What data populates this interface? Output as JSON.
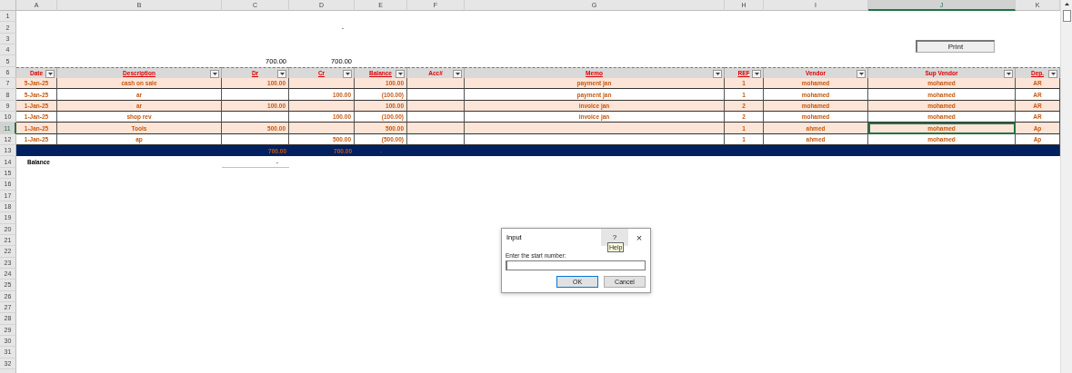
{
  "column_headers": [
    {
      "label": "A",
      "selected": false
    },
    {
      "label": "B",
      "selected": false
    },
    {
      "label": "C",
      "selected": false
    },
    {
      "label": "D",
      "selected": false
    },
    {
      "label": "E",
      "selected": false
    },
    {
      "label": "F",
      "selected": false
    },
    {
      "label": "G",
      "selected": false
    },
    {
      "label": "H",
      "selected": false
    },
    {
      "label": "I",
      "selected": false
    },
    {
      "label": "J",
      "selected": true
    },
    {
      "label": "K",
      "selected": false
    }
  ],
  "row_headers": [
    {
      "label": "1",
      "selected": false
    },
    {
      "label": "2",
      "selected": false
    },
    {
      "label": "3",
      "selected": false
    },
    {
      "label": "4",
      "selected": false
    },
    {
      "label": "5",
      "selected": false
    },
    {
      "label": "6",
      "selected": false
    },
    {
      "label": "7",
      "selected": false
    },
    {
      "label": "8",
      "selected": false
    },
    {
      "label": "9",
      "selected": false
    },
    {
      "label": "10",
      "selected": false
    },
    {
      "label": "11",
      "selected": true
    },
    {
      "label": "12",
      "selected": false
    },
    {
      "label": "13",
      "selected": false
    },
    {
      "label": "14",
      "selected": false
    },
    {
      "label": "15",
      "selected": false
    },
    {
      "label": "16",
      "selected": false
    },
    {
      "label": "17",
      "selected": false
    },
    {
      "label": "18",
      "selected": false
    },
    {
      "label": "19",
      "selected": false
    },
    {
      "label": "20",
      "selected": false
    },
    {
      "label": "21",
      "selected": false
    },
    {
      "label": "22",
      "selected": false
    },
    {
      "label": "23",
      "selected": false
    },
    {
      "label": "24",
      "selected": false
    },
    {
      "label": "25",
      "selected": false
    },
    {
      "label": "26",
      "selected": false
    },
    {
      "label": "27",
      "selected": false
    },
    {
      "label": "28",
      "selected": false
    },
    {
      "label": "29",
      "selected": false
    },
    {
      "label": "30",
      "selected": false
    },
    {
      "label": "31",
      "selected": false
    },
    {
      "label": "32",
      "selected": false
    }
  ],
  "cell_d2": "-",
  "totals_above": {
    "dr": "700.00",
    "cr": "700.00"
  },
  "print_button": "Print",
  "table": {
    "headers": [
      {
        "label": "Date",
        "underlined": false
      },
      {
        "label": "Description",
        "underlined": true
      },
      {
        "label": "Dr",
        "underlined": true
      },
      {
        "label": "Cr",
        "underlined": true
      },
      {
        "label": "Balance",
        "underlined": true
      },
      {
        "label": "Acc#",
        "underlined": false
      },
      {
        "label": "Memo",
        "underlined": true
      },
      {
        "label": "REF",
        "underlined": true
      },
      {
        "label": "Vendor",
        "underlined": false
      },
      {
        "label": "Sup Vendor",
        "underlined": false
      },
      {
        "label": "Dep.",
        "underlined": true
      }
    ],
    "rows": [
      {
        "cells": [
          {
            "text": "5-Jan-25",
            "selected": false
          },
          {
            "text": "cash on sale",
            "selected": false
          },
          {
            "text": "100.00",
            "selected": false
          },
          {
            "selected": false
          },
          {
            "text": "100.00",
            "selected": false
          },
          {
            "selected": false
          },
          {
            "text": "payment jan",
            "selected": false
          },
          {
            "text": "1",
            "selected": false
          },
          {
            "text": "mohamed",
            "selected": false
          },
          {
            "text": "mohamed",
            "selected": false
          },
          {
            "text": "AR",
            "selected": false
          }
        ]
      },
      {
        "cells": [
          {
            "text": "5-Jan-25",
            "selected": false
          },
          {
            "text": "ar",
            "selected": false
          },
          {
            "selected": false
          },
          {
            "text": "100.00",
            "selected": false
          },
          {
            "text": "(100.00)",
            "selected": false
          },
          {
            "selected": false
          },
          {
            "text": "payment jan",
            "selected": false
          },
          {
            "text": "1",
            "selected": false
          },
          {
            "text": "mohamed",
            "selected": false
          },
          {
            "text": "mohamed",
            "selected": false
          },
          {
            "text": "AR",
            "selected": false
          }
        ]
      },
      {
        "cells": [
          {
            "text": "1-Jan-25",
            "selected": false
          },
          {
            "text": "ar",
            "selected": false
          },
          {
            "text": "100.00",
            "selected": false
          },
          {
            "selected": false
          },
          {
            "text": "100.00",
            "selected": false
          },
          {
            "selected": false
          },
          {
            "text": "invoice jan",
            "selected": false
          },
          {
            "text": "2",
            "selected": false
          },
          {
            "text": "mohamed",
            "selected": false
          },
          {
            "text": "mohamed",
            "selected": false
          },
          {
            "text": "AR",
            "selected": false
          }
        ]
      },
      {
        "cells": [
          {
            "text": "1-Jan-25",
            "selected": false
          },
          {
            "text": "shop rev",
            "selected": false
          },
          {
            "selected": false
          },
          {
            "text": "100.00",
            "selected": false
          },
          {
            "text": "(100.00)",
            "selected": false
          },
          {
            "selected": false
          },
          {
            "text": "invoice jan",
            "selected": false
          },
          {
            "text": "2",
            "selected": false
          },
          {
            "text": "mohamed",
            "selected": false
          },
          {
            "text": "mohamed",
            "selected": false
          },
          {
            "text": "AR",
            "selected": false
          }
        ]
      },
      {
        "cells": [
          {
            "text": "1-Jan-25",
            "selected": false
          },
          {
            "text": "Tools",
            "selected": false
          },
          {
            "text": "500.00",
            "selected": false
          },
          {
            "selected": false
          },
          {
            "text": "500.00",
            "selected": false
          },
          {
            "selected": false
          },
          {
            "selected": false
          },
          {
            "text": "1",
            "selected": false
          },
          {
            "text": "ahmed",
            "selected": false
          },
          {
            "text": "mohamed",
            "selected": true
          },
          {
            "text": "Ap",
            "selected": false
          }
        ]
      },
      {
        "cells": [
          {
            "text": "1-Jan-25",
            "selected": false
          },
          {
            "text": "ap",
            "selected": false
          },
          {
            "selected": false
          },
          {
            "text": "500.00",
            "selected": false
          },
          {
            "text": "(500.00)",
            "selected": false
          },
          {
            "selected": false
          },
          {
            "selected": false
          },
          {
            "text": "1",
            "selected": false
          },
          {
            "text": "ahmed",
            "selected": false
          },
          {
            "text": "mohamed",
            "selected": false
          },
          {
            "text": "Ap",
            "selected": false
          }
        ]
      }
    ],
    "total_row": {
      "dr": "700.00",
      "cr": "700.00",
      "balance": "-"
    }
  },
  "balance_row": {
    "label": "Balance",
    "value": "-"
  },
  "dialog": {
    "title": "Input",
    "help_button": "?",
    "help_tooltip": "Help",
    "close_button": "×",
    "prompt": "Enter the start number:",
    "buttons": [
      {
        "label": "OK",
        "selected": true
      },
      {
        "label": "Cancel",
        "selected": false
      }
    ]
  }
}
